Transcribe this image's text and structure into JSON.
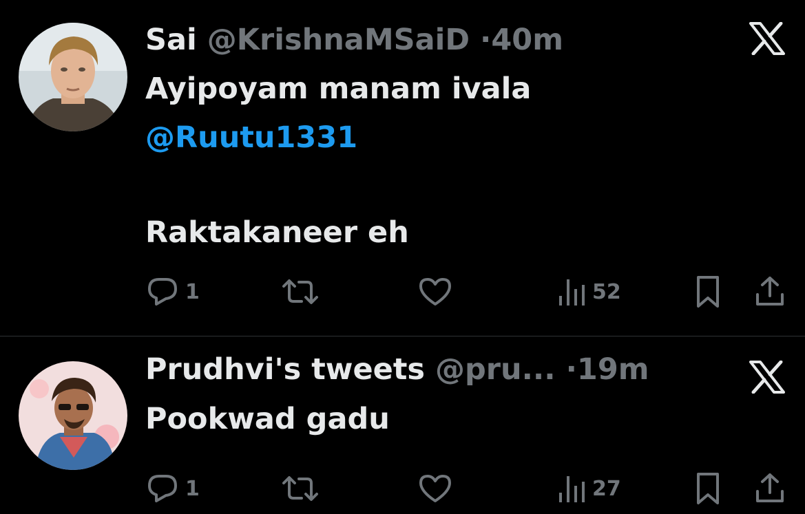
{
  "tweets": [
    {
      "author_name": "Sai",
      "handle": "@KrishnaMSaiD",
      "dot": "·",
      "time": "40m",
      "lines": [
        "Ayipoyam manam ivala"
      ],
      "mention": "@Ruutu1331",
      "lines_after": [
        "Raktakaneer eh"
      ],
      "replies": "1",
      "views": "52",
      "avatar_icon": "portrait-avatar-icon"
    },
    {
      "author_name": "Prudhvi's tweets",
      "handle": "@pru...",
      "dot": "·",
      "time": "19m",
      "lines": [
        "Pookwad gadu"
      ],
      "replies": "1",
      "views": "27",
      "avatar_icon": "portrait-avatar-icon"
    }
  ],
  "icons": {
    "logo": "x-logo-icon",
    "reply": "reply-icon",
    "retweet": "retweet-icon",
    "like": "heart-icon",
    "views": "views-icon",
    "bookmark": "bookmark-icon",
    "share": "share-icon"
  },
  "colors": {
    "background": "#000000",
    "text": "#e7e9ea",
    "muted": "#71767b",
    "mention": "#1d9bf0",
    "divider": "#2f3336"
  }
}
